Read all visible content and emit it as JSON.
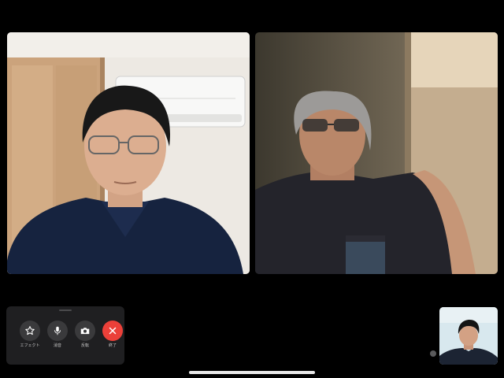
{
  "controls": {
    "effects": {
      "label": "エフェクト",
      "icon": "star-icon"
    },
    "mute": {
      "label": "消音",
      "icon": "microphone-icon"
    },
    "flip": {
      "label": "反転",
      "icon": "camera-icon"
    },
    "end": {
      "label": "終了",
      "icon": "close-icon"
    }
  },
  "colors": {
    "background": "#000000",
    "panel": "#1f1f21",
    "button": "#3a3a3c",
    "end_button": "#eb4039"
  }
}
